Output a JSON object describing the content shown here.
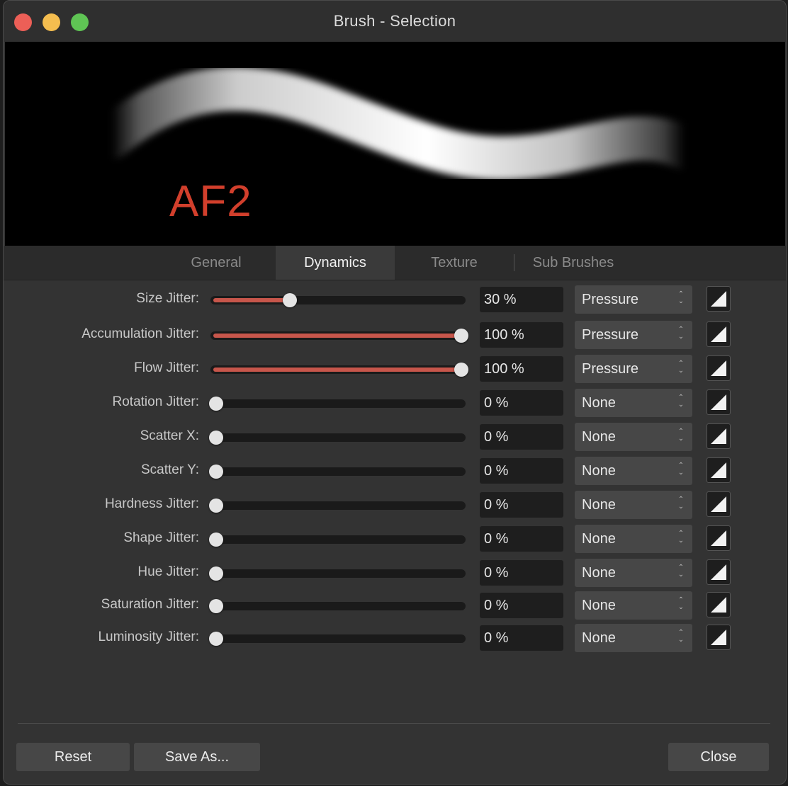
{
  "window": {
    "title": "Brush - Selection"
  },
  "preview": {
    "overlay_text": "AF2",
    "overlay_color": "#d23f2c"
  },
  "tabs": [
    {
      "label": "General",
      "active": false
    },
    {
      "label": "Dynamics",
      "active": true
    },
    {
      "label": "Texture",
      "active": false
    },
    {
      "label": "Sub Brushes",
      "active": false
    }
  ],
  "rows": [
    {
      "label": "Size Jitter:",
      "value": "30 %",
      "fraction": 0.3,
      "controller": "Pressure"
    },
    {
      "label": "Accumulation Jitter:",
      "value": "100 %",
      "fraction": 1.0,
      "controller": "Pressure"
    },
    {
      "label": "Flow Jitter:",
      "value": "100 %",
      "fraction": 1.0,
      "controller": "Pressure"
    },
    {
      "label": "Rotation Jitter:",
      "value": "0 %",
      "fraction": 0,
      "controller": "None"
    },
    {
      "label": "Scatter X:",
      "value": "0 %",
      "fraction": 0,
      "controller": "None"
    },
    {
      "label": "Scatter Y:",
      "value": "0 %",
      "fraction": 0,
      "controller": "None"
    },
    {
      "label": "Hardness Jitter:",
      "value": "0 %",
      "fraction": 0,
      "controller": "None"
    },
    {
      "label": "Shape Jitter:",
      "value": "0 %",
      "fraction": 0,
      "controller": "None"
    },
    {
      "label": "Hue Jitter:",
      "value": "0 %",
      "fraction": 0,
      "controller": "None"
    },
    {
      "label": "Saturation Jitter:",
      "value": "0 %",
      "fraction": 0,
      "controller": "None"
    },
    {
      "label": "Luminosity Jitter:",
      "value": "0 %",
      "fraction": 0,
      "controller": "None"
    }
  ],
  "buttons": {
    "reset": "Reset",
    "save_as": "Save As...",
    "close": "Close"
  },
  "colors": {
    "accent": "#c7564b",
    "close_light": "#ec5f57",
    "minimize_light": "#f4bd4f",
    "maximize_light": "#5fc454"
  }
}
